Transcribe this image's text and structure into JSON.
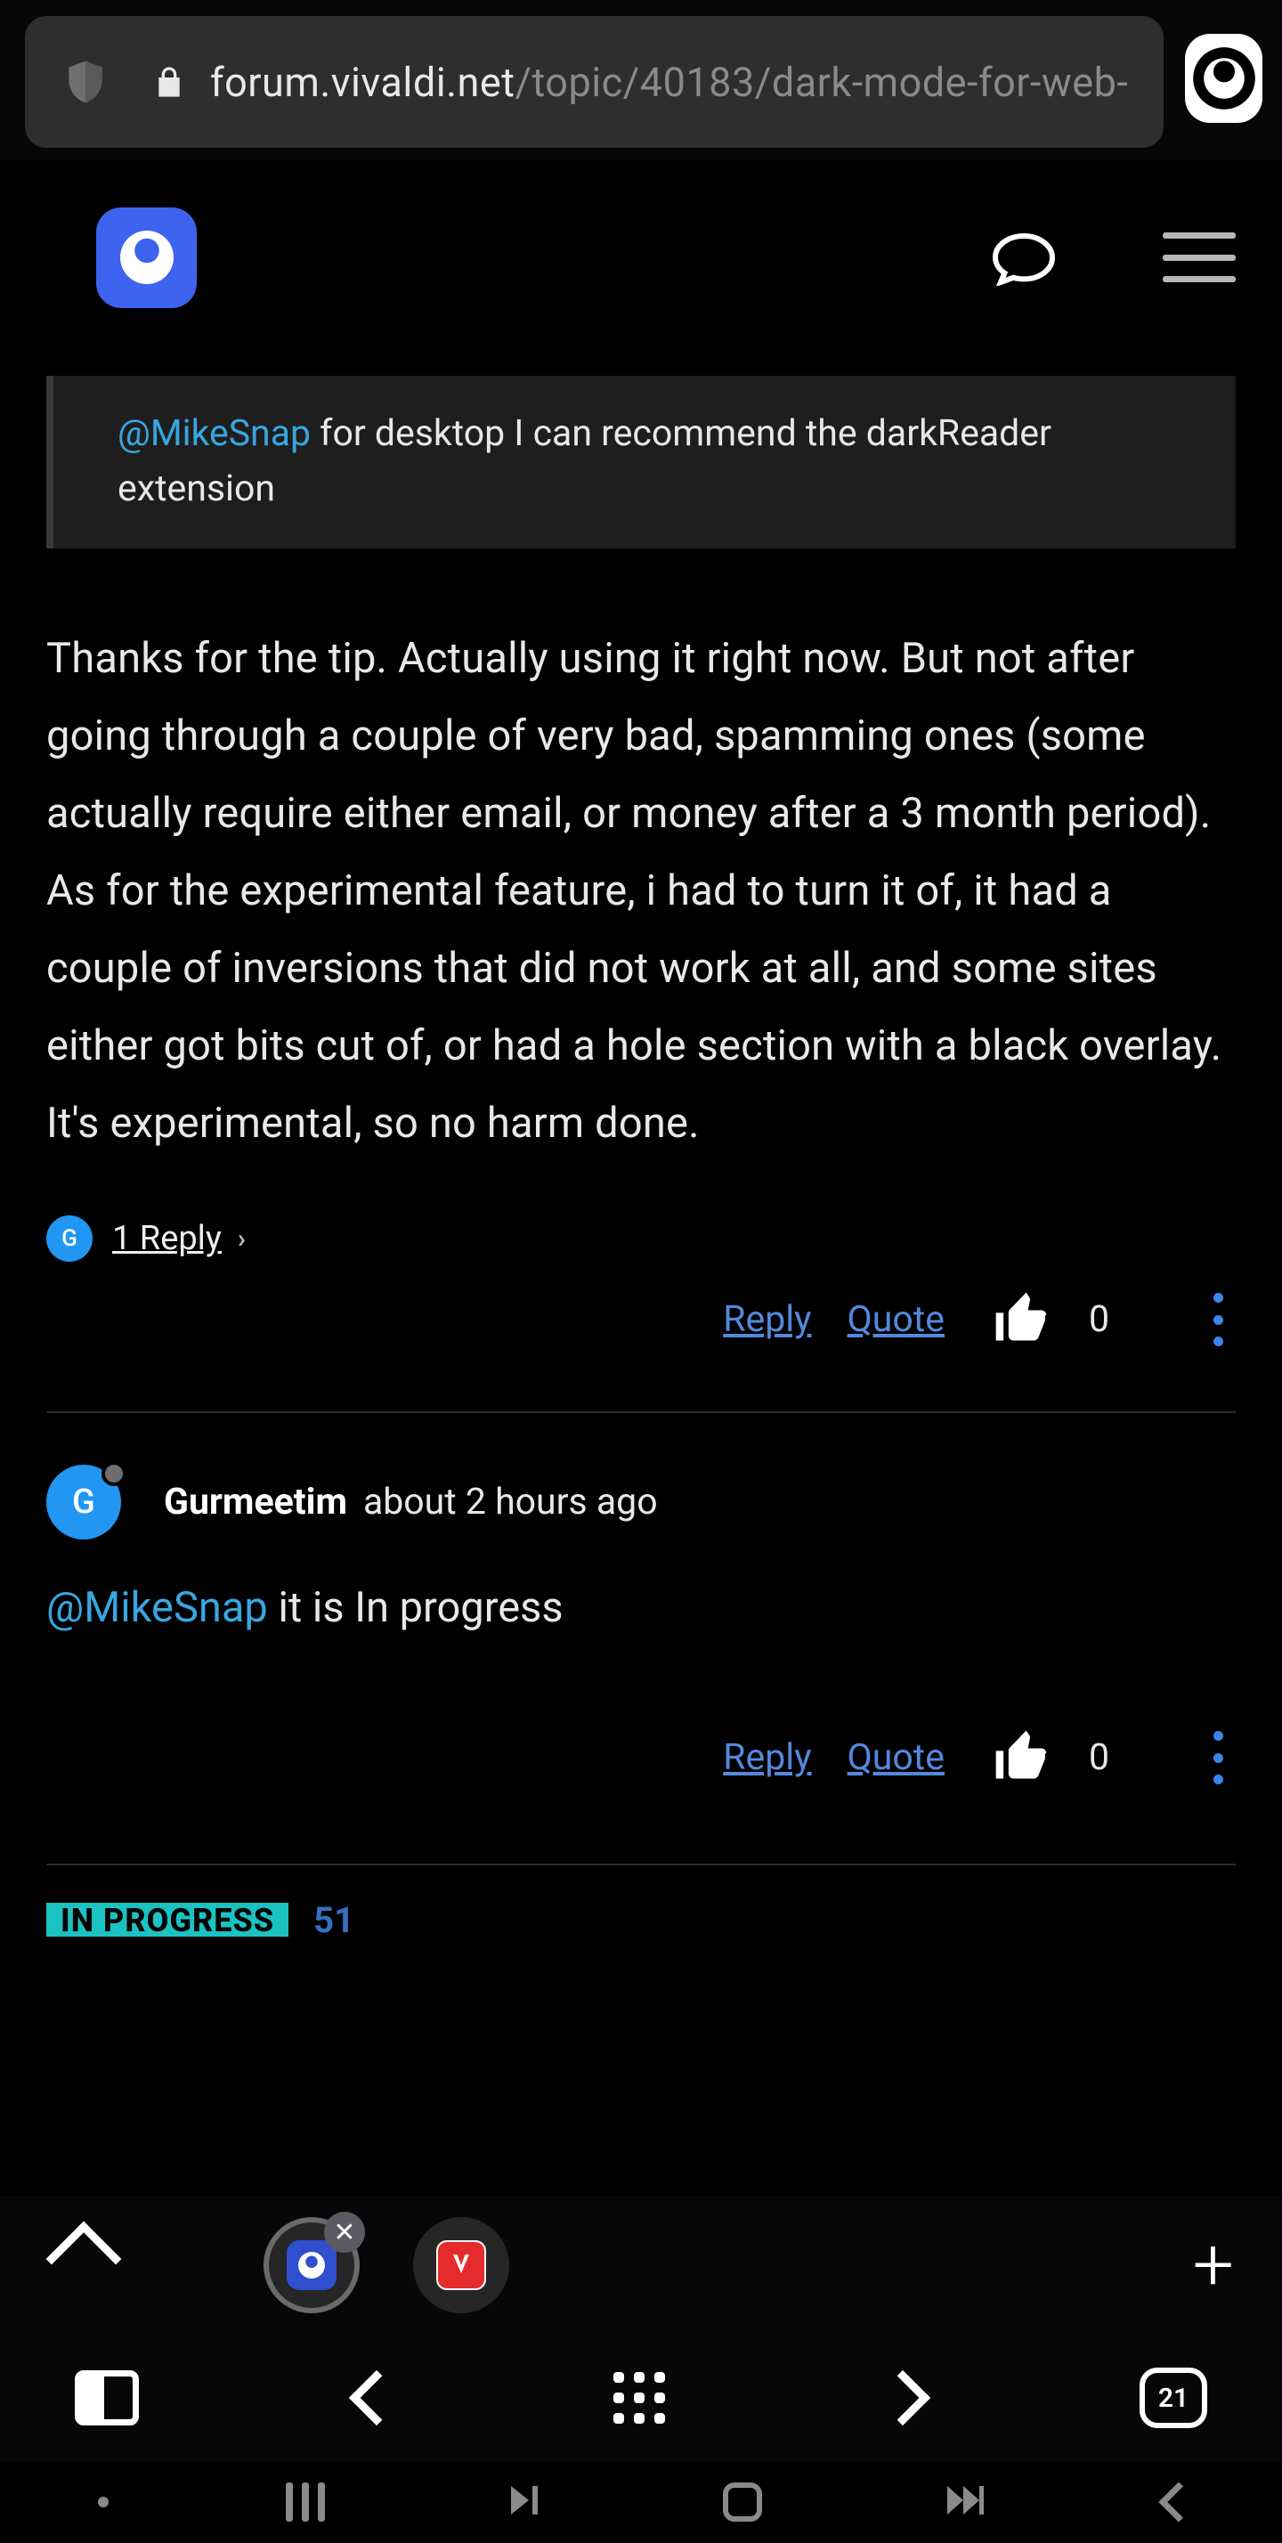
{
  "browser": {
    "url_host": "forum.vivaldi.net",
    "url_path": "/topic/40183/dark-mode-for-web-"
  },
  "post1": {
    "quote_mention": "@MikeSnap",
    "quote_text": " for desktop I can recommend the darkReader extension",
    "body_p1": "Thanks for the tip. Actually using it right now. But not after going through a couple of very bad, spamming ones (some actually require either email, or money after a 3 month period).",
    "body_p2": "As for the experimental feature, i had to turn it of, it had a couple of inversions that did not work at all, and some sites either got bits cut of, or had a hole section with a black overlay. It's experimental, so no harm done.",
    "reply_avatar_initial": "G",
    "reply_count_label": "1 Reply ",
    "actions": {
      "reply": "Reply",
      "quote": "Quote",
      "votes": "0"
    }
  },
  "post2": {
    "avatar_initial": "G",
    "username": "Gurmeetim",
    "timestamp": "about 2 hours ago",
    "mention": "@MikeSnap",
    "body_rest": " it is In progress",
    "actions": {
      "reply": "Reply",
      "quote": "Quote",
      "votes": "0"
    }
  },
  "status": {
    "chip": "IN PROGRESS",
    "count": "51"
  },
  "toolbar": {
    "tabs_count": "21"
  }
}
